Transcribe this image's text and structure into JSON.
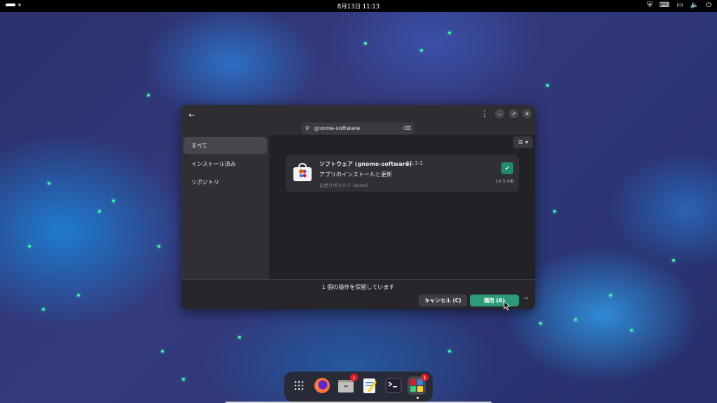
{
  "topbar": {
    "clock": "8月13日  11:13",
    "tray_icons": [
      "shield-icon",
      "keyboard-icon",
      "screen-icon",
      "volume-icon",
      "power-icon"
    ]
  },
  "window": {
    "search": {
      "value": "gnome-software"
    },
    "sidebar": {
      "items": [
        {
          "label": "すべて"
        },
        {
          "label": "インストール済み"
        },
        {
          "label": "リポジトリ"
        }
      ]
    },
    "app_card": {
      "name": "ソフトウェア (gnome-software)",
      "version": "50.3-1",
      "description": "アプリのインストールと更新",
      "repository": "公式リポジトリ (extra)",
      "size": "14.5 MB"
    },
    "footer": {
      "pending_text": "1 個の操作を保留しています",
      "cancel_label": "キャンセル (C)",
      "apply_label": "適用 (A)"
    }
  },
  "dock": {
    "items": [
      {
        "name": "app-grid"
      },
      {
        "name": "firefox"
      },
      {
        "name": "file-manager",
        "badge": "1"
      },
      {
        "name": "text-editor"
      },
      {
        "name": "terminal"
      },
      {
        "name": "software-center",
        "badge": "1"
      }
    ]
  },
  "colors": {
    "accent": "#2b9b7a",
    "badge": "#e01b24"
  }
}
